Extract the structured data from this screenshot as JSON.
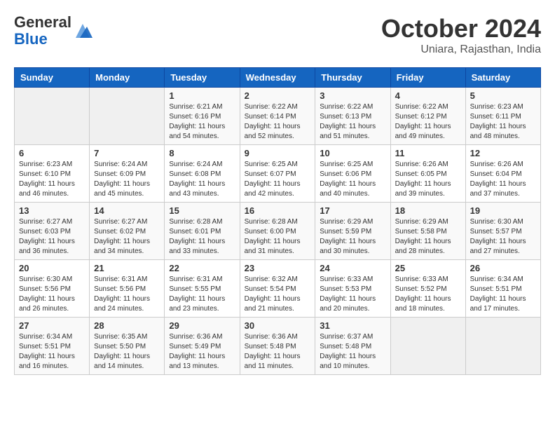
{
  "header": {
    "logo_general": "General",
    "logo_blue": "Blue",
    "month_title": "October 2024",
    "location": "Uniara, Rajasthan, India"
  },
  "days_of_week": [
    "Sunday",
    "Monday",
    "Tuesday",
    "Wednesday",
    "Thursday",
    "Friday",
    "Saturday"
  ],
  "weeks": [
    [
      {
        "day": "",
        "info": ""
      },
      {
        "day": "",
        "info": ""
      },
      {
        "day": "1",
        "info": "Sunrise: 6:21 AM\nSunset: 6:16 PM\nDaylight: 11 hours and 54 minutes."
      },
      {
        "day": "2",
        "info": "Sunrise: 6:22 AM\nSunset: 6:14 PM\nDaylight: 11 hours and 52 minutes."
      },
      {
        "day": "3",
        "info": "Sunrise: 6:22 AM\nSunset: 6:13 PM\nDaylight: 11 hours and 51 minutes."
      },
      {
        "day": "4",
        "info": "Sunrise: 6:22 AM\nSunset: 6:12 PM\nDaylight: 11 hours and 49 minutes."
      },
      {
        "day": "5",
        "info": "Sunrise: 6:23 AM\nSunset: 6:11 PM\nDaylight: 11 hours and 48 minutes."
      }
    ],
    [
      {
        "day": "6",
        "info": "Sunrise: 6:23 AM\nSunset: 6:10 PM\nDaylight: 11 hours and 46 minutes."
      },
      {
        "day": "7",
        "info": "Sunrise: 6:24 AM\nSunset: 6:09 PM\nDaylight: 11 hours and 45 minutes."
      },
      {
        "day": "8",
        "info": "Sunrise: 6:24 AM\nSunset: 6:08 PM\nDaylight: 11 hours and 43 minutes."
      },
      {
        "day": "9",
        "info": "Sunrise: 6:25 AM\nSunset: 6:07 PM\nDaylight: 11 hours and 42 minutes."
      },
      {
        "day": "10",
        "info": "Sunrise: 6:25 AM\nSunset: 6:06 PM\nDaylight: 11 hours and 40 minutes."
      },
      {
        "day": "11",
        "info": "Sunrise: 6:26 AM\nSunset: 6:05 PM\nDaylight: 11 hours and 39 minutes."
      },
      {
        "day": "12",
        "info": "Sunrise: 6:26 AM\nSunset: 6:04 PM\nDaylight: 11 hours and 37 minutes."
      }
    ],
    [
      {
        "day": "13",
        "info": "Sunrise: 6:27 AM\nSunset: 6:03 PM\nDaylight: 11 hours and 36 minutes."
      },
      {
        "day": "14",
        "info": "Sunrise: 6:27 AM\nSunset: 6:02 PM\nDaylight: 11 hours and 34 minutes."
      },
      {
        "day": "15",
        "info": "Sunrise: 6:28 AM\nSunset: 6:01 PM\nDaylight: 11 hours and 33 minutes."
      },
      {
        "day": "16",
        "info": "Sunrise: 6:28 AM\nSunset: 6:00 PM\nDaylight: 11 hours and 31 minutes."
      },
      {
        "day": "17",
        "info": "Sunrise: 6:29 AM\nSunset: 5:59 PM\nDaylight: 11 hours and 30 minutes."
      },
      {
        "day": "18",
        "info": "Sunrise: 6:29 AM\nSunset: 5:58 PM\nDaylight: 11 hours and 28 minutes."
      },
      {
        "day": "19",
        "info": "Sunrise: 6:30 AM\nSunset: 5:57 PM\nDaylight: 11 hours and 27 minutes."
      }
    ],
    [
      {
        "day": "20",
        "info": "Sunrise: 6:30 AM\nSunset: 5:56 PM\nDaylight: 11 hours and 26 minutes."
      },
      {
        "day": "21",
        "info": "Sunrise: 6:31 AM\nSunset: 5:56 PM\nDaylight: 11 hours and 24 minutes."
      },
      {
        "day": "22",
        "info": "Sunrise: 6:31 AM\nSunset: 5:55 PM\nDaylight: 11 hours and 23 minutes."
      },
      {
        "day": "23",
        "info": "Sunrise: 6:32 AM\nSunset: 5:54 PM\nDaylight: 11 hours and 21 minutes."
      },
      {
        "day": "24",
        "info": "Sunrise: 6:33 AM\nSunset: 5:53 PM\nDaylight: 11 hours and 20 minutes."
      },
      {
        "day": "25",
        "info": "Sunrise: 6:33 AM\nSunset: 5:52 PM\nDaylight: 11 hours and 18 minutes."
      },
      {
        "day": "26",
        "info": "Sunrise: 6:34 AM\nSunset: 5:51 PM\nDaylight: 11 hours and 17 minutes."
      }
    ],
    [
      {
        "day": "27",
        "info": "Sunrise: 6:34 AM\nSunset: 5:51 PM\nDaylight: 11 hours and 16 minutes."
      },
      {
        "day": "28",
        "info": "Sunrise: 6:35 AM\nSunset: 5:50 PM\nDaylight: 11 hours and 14 minutes."
      },
      {
        "day": "29",
        "info": "Sunrise: 6:36 AM\nSunset: 5:49 PM\nDaylight: 11 hours and 13 minutes."
      },
      {
        "day": "30",
        "info": "Sunrise: 6:36 AM\nSunset: 5:48 PM\nDaylight: 11 hours and 11 minutes."
      },
      {
        "day": "31",
        "info": "Sunrise: 6:37 AM\nSunset: 5:48 PM\nDaylight: 11 hours and 10 minutes."
      },
      {
        "day": "",
        "info": ""
      },
      {
        "day": "",
        "info": ""
      }
    ]
  ]
}
